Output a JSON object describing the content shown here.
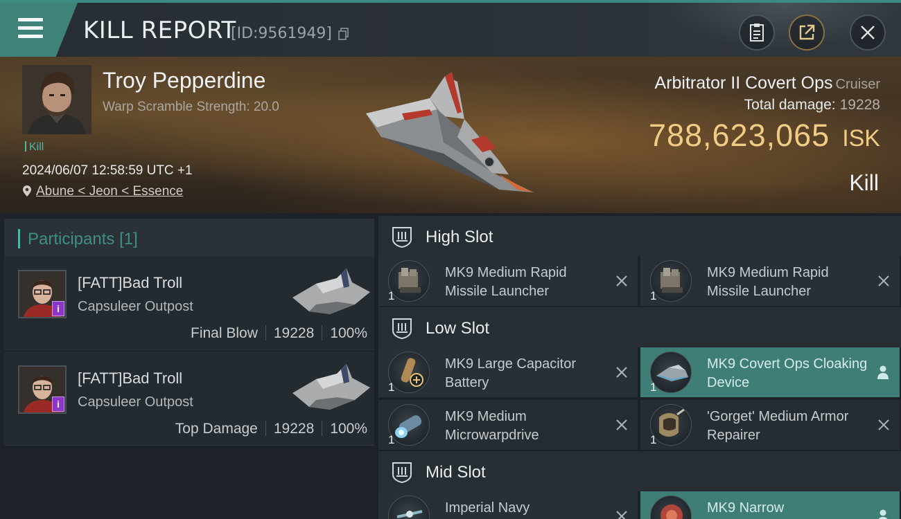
{
  "header": {
    "title": "KILL REPORT",
    "report_id": "[ID:9561949]"
  },
  "victim": {
    "name": "Troy Pepperdine",
    "warp_scramble": "Warp Scramble Strength: 20.0",
    "tag": "Kill",
    "datetime": "2024/06/07 12:58:59 UTC +1",
    "location": "Abune < Jeon < Essence"
  },
  "ship": {
    "name": "Arbitrator II Covert Ops",
    "class": "Cruiser",
    "total_damage_label": "Total damage:",
    "total_damage": "19228",
    "isk_value": "788,623,065",
    "isk_unit": "ISK",
    "result": "Kill"
  },
  "participants": {
    "label": "Participants",
    "count": "[1]",
    "cards": [
      {
        "name": "[FATT]Bad Troll",
        "corp": "Capsuleer Outpost",
        "role": "Final Blow",
        "damage": "19228",
        "percent": "100%"
      },
      {
        "name": "[FATT]Bad Troll",
        "corp": "Capsuleer Outpost",
        "role": "Top Damage",
        "damage": "19228",
        "percent": "100%"
      }
    ]
  },
  "slots": {
    "high": {
      "label": "High Slot",
      "modules": [
        {
          "name": "MK9 Medium Rapid Missile Launcher",
          "qty": "1",
          "status": "destroyed"
        },
        {
          "name": "MK9 Medium Rapid Missile Launcher",
          "qty": "1",
          "status": "destroyed"
        }
      ]
    },
    "low": {
      "label": "Low Slot",
      "modules": [
        {
          "name": "MK9 Large Capacitor Battery",
          "qty": "1",
          "status": "destroyed"
        },
        {
          "name": "MK9 Covert Ops Cloaking Device",
          "qty": "1",
          "status": "dropped"
        },
        {
          "name": "MK9 Medium Microwarpdrive",
          "qty": "1",
          "status": "destroyed"
        },
        {
          "name": "'Gorget' Medium Armor Repairer",
          "qty": "1",
          "status": "destroyed"
        }
      ]
    },
    "mid": {
      "label": "Mid Slot",
      "modules": [
        {
          "name": "Imperial Navy",
          "qty": "1",
          "status": "destroyed"
        },
        {
          "name": "MK9 Narrow",
          "qty": "1",
          "status": "dropped"
        }
      ]
    }
  },
  "colors": {
    "accent_teal": "#3e8279",
    "isk_gold": "#f0cc84",
    "highlight_cell": "#3f7e76",
    "implant_badge": "#8c36c9"
  }
}
